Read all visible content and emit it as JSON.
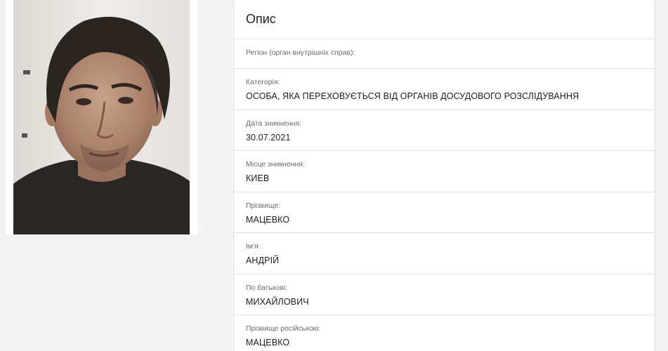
{
  "description": {
    "title": "Опис",
    "fields": [
      {
        "label": "Регіон (орган внутрішніх справ):",
        "value": ""
      },
      {
        "label": "Категорія:",
        "value": "ОСОБА, ЯКА ПЕРЕХОВУЄТЬСЯ ВІД ОРГАНІВ ДОСУДОВОГО РОЗСЛІДУВАННЯ"
      },
      {
        "label": "Дата зникнення:",
        "value": "30.07.2021"
      },
      {
        "label": "Місце зникнення:",
        "value": "КИЕВ"
      },
      {
        "label": "Прізвище:",
        "value": "МАЦЕВКО"
      },
      {
        "label": "Ім'я:",
        "value": "АНДРІЙ"
      },
      {
        "label": "По батькові:",
        "value": "МИХАЙЛОВИЧ"
      },
      {
        "label": "Прізвище російською:",
        "value": "МАЦЕВКО"
      }
    ]
  }
}
